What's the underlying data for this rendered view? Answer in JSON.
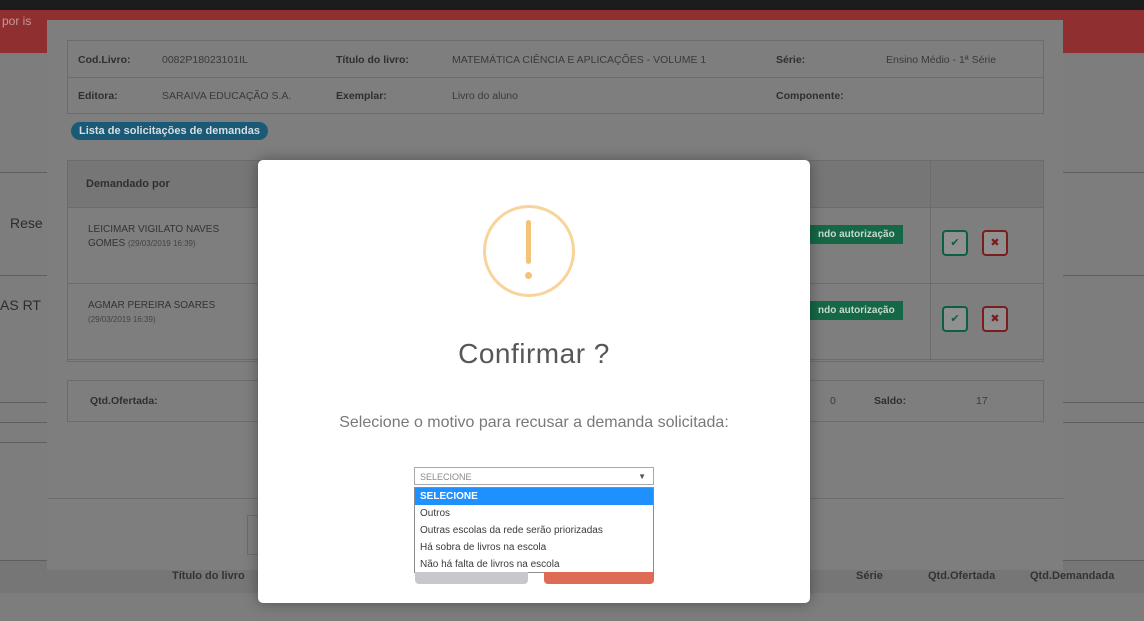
{
  "background": {
    "red_bar_text": "por is",
    "left_texts": [
      "Rese",
      "AS RT"
    ],
    "bottom_table_headers": [
      "Título do livro",
      "Série",
      "Qtd.Ofertada",
      "Qtd.Demandada"
    ]
  },
  "outer_modal": {
    "info": {
      "cod_livro_label": "Cod.Livro:",
      "cod_livro_value": "0082P18023101IL",
      "titulo_label": "Título do livro:",
      "titulo_value": "MATEMÁTICA CIÊNCIA E APLICAÇÕES - VOLUME 1",
      "serie_label": "Série:",
      "serie_value": "Ensino Médio - 1ª Série",
      "editora_label": "Editora:",
      "editora_value": "SARAIVA EDUCAÇÃO S.A.",
      "exemplar_label": "Exemplar:",
      "exemplar_value": "Livro do aluno",
      "componente_label": "Componente:"
    },
    "list_pill": "Lista de solicitações de demandas",
    "table": {
      "header_demandado": "Demandado por",
      "rows": [
        {
          "name": "LEICIMAR VIGILATO NAVES GOMES",
          "date": "(29/03/2019 16:39)",
          "status": "ndo autorização"
        },
        {
          "name": "AGMAR PEREIRA SOARES",
          "date": "(29/03/2019 16:39)",
          "status": "ndo autorização"
        }
      ]
    },
    "qtd": {
      "ofertada_label": "Qtd.Ofertada:",
      "middle_value": "0",
      "saldo_label": "Saldo:",
      "saldo_value": "17"
    }
  },
  "dialog": {
    "title": "Confirmar ?",
    "message": "Selecione o motivo para recusar a demanda solicitada:",
    "select_value": "SELECIONE",
    "options": [
      "SELECIONE",
      "Outros",
      "Outras escolas da rede serão priorizadas",
      "Há sobra de livros na escola",
      "Não há falta de livros na escola"
    ],
    "selected_index": 0,
    "colors": {
      "confirm": "#dd6b55",
      "cancel": "#c6c8cd",
      "warning": "#f8bb86",
      "highlight": "#1e90ff"
    },
    "icon": "warning-icon"
  }
}
